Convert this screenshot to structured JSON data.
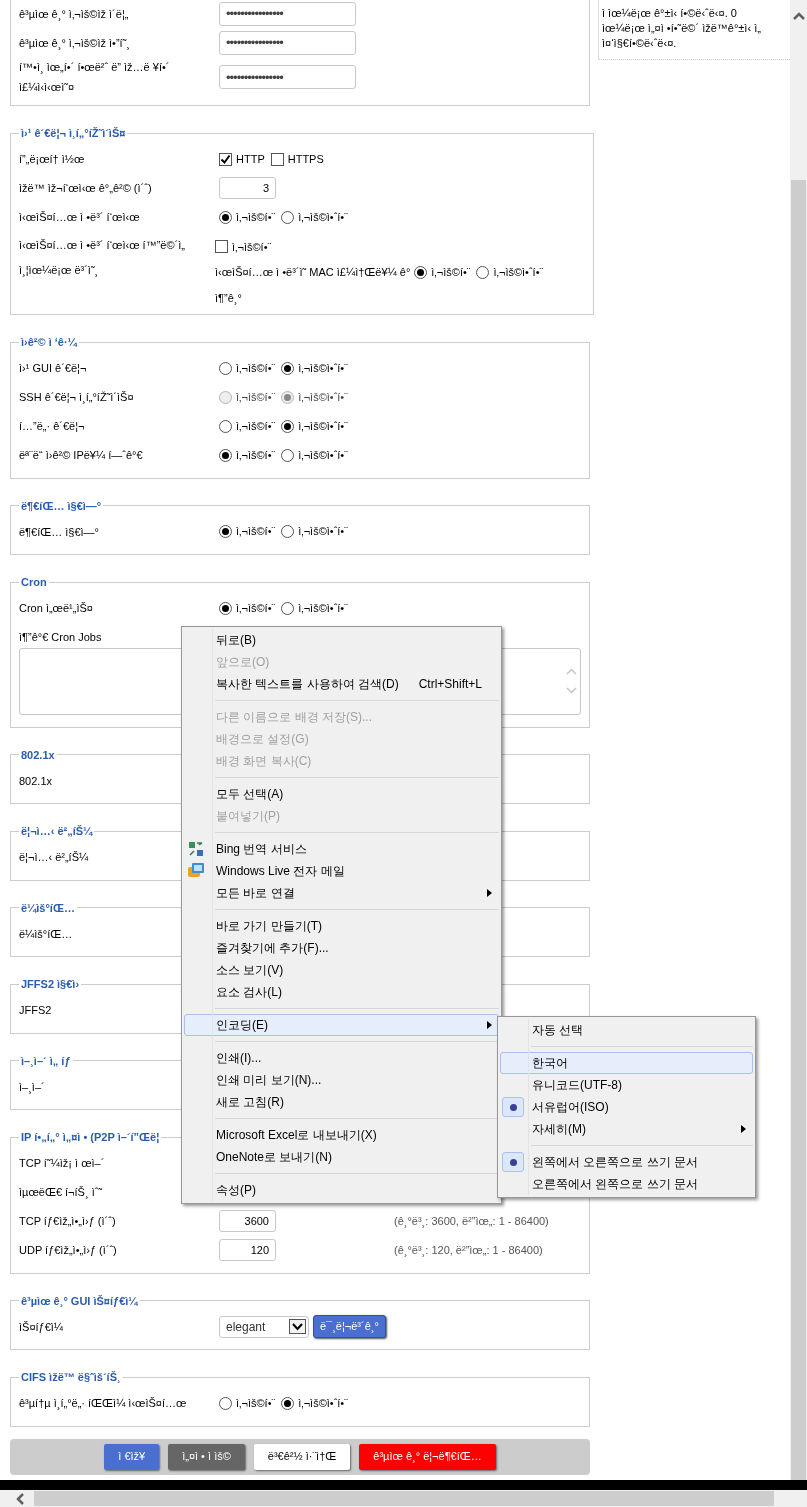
{
  "sections": [
    {
      "rows": [
        {
          "kind": "password",
          "label": "ê³µìœ ê¸° ì‚¬ìš©ìž ì´ë¦„",
          "value": "••••••••••••••••"
        },
        {
          "kind": "password",
          "label": "ê³µìœ ê¸° ì‚¬ìš©ìž ì•”í˜¸",
          "value": "••••••••••••••••"
        },
        {
          "kind": "password",
          "label": "í™•ì¸ ìœ„í•´ í•œë²ˆ ë” ìž…ë ¥í•´ ì£¼ì‹ì‹œì˜¤",
          "value": "••••••••••••••••"
        }
      ]
    },
    {
      "title": "ì›¹ ê´€ë¦¬ ì¸í„°íŽ˜ì´ìŠ¤",
      "rows": [
        {
          "kind": "checkboxes",
          "label": "í”„ë¡œí† ì½œ",
          "options": [
            {
              "label": "HTTP",
              "checked": true
            },
            {
              "label": "HTTPS",
              "checked": false
            }
          ]
        },
        {
          "kind": "number",
          "label": "ìžë™ ìž¬í‘œì‹œ ê°„ê²© (ì´ˆ)",
          "value": "3"
        },
        {
          "kind": "radios",
          "label": "ì‹œìŠ¤í…œ ì •ë³´ í‘œì‹œ",
          "disabled": false,
          "options": [
            {
              "label": "ì‚¬ìš©í•¨",
              "selected": true
            },
            {
              "label": "ì‚¬ìš©ì•ˆí•¨",
              "selected": false
            }
          ]
        },
        {
          "kind": "mac",
          "label": "ì‹œìŠ¤í…œ ì •ë³´ í‘œì‹œ í™”ë©´ì„ ì¸¦ìœ¼ë¡œ ë³´ì˜¸",
          "checkbox": {
            "label": "ì‚¬ìš©í•¨",
            "checked": false
          },
          "mac_label": "ì‹œìŠ¤í…œ ì •ë³´ì˜ MAC ì£¼ì†Œë¥¼ ê°",
          "options": [
            {
              "label": "ì‚¬ìš©í•¨",
              "selected": true
            },
            {
              "label": "ì‚¬ìš©ì•ˆí•¨",
              "selected": false
            }
          ],
          "mac_suffix": "ì¶”ê¸°"
        }
      ]
    },
    {
      "title": "ì›ê²© ì ‘ê·¼",
      "rows": [
        {
          "kind": "radios",
          "label": "ì›¹ GUI ê´€ë¦¬",
          "disabled": false,
          "options": [
            {
              "label": "ì‚¬ìš©í•¨",
              "selected": false
            },
            {
              "label": "ì‚¬ìš©ì•ˆí•¨",
              "selected": true
            }
          ]
        },
        {
          "kind": "radios",
          "label": "SSH ê´€ë¦¬ ì¸í„°íŽ˜ì´ìŠ¤",
          "disabled": true,
          "options": [
            {
              "label": "ì‚¬ìš©í•¨",
              "selected": false
            },
            {
              "label": "ì‚¬ìš©ì•ˆí•¨",
              "selected": true
            }
          ]
        },
        {
          "kind": "radios",
          "label": "í…”ë„· ê´€ë¦¬",
          "disabled": false,
          "options": [
            {
              "label": "ì‚¬ìš©í•¨",
              "selected": false
            },
            {
              "label": "ì‚¬ìš©ì•ˆí•¨",
              "selected": true
            }
          ]
        },
        {
          "kind": "radios",
          "label": "ëª¨ë“  ì›ê²© IPë¥¼ í—ˆê°€",
          "disabled": false,
          "options": [
            {
              "label": "ì‚¬ìš©í•¨",
              "selected": true
            },
            {
              "label": "ì‚¬ìš©ì•ˆí•¨",
              "selected": false
            }
          ]
        }
      ]
    },
    {
      "title": "ë¶€íŒ… ì§€ì—°",
      "rows": [
        {
          "kind": "radios",
          "label": "ë¶€íŒ… ì§€ì—°",
          "disabled": false,
          "options": [
            {
              "label": "ì‚¬ìš©í•¨",
              "selected": true
            },
            {
              "label": "ì‚¬ìš©ì•ˆí•¨",
              "selected": false
            }
          ]
        }
      ]
    },
    {
      "title": "Cron",
      "rows": [
        {
          "kind": "radios",
          "label": "Cron ì„œë¹„ìŠ¤",
          "disabled": false,
          "options": [
            {
              "label": "ì‚¬ìš©í•¨",
              "selected": true
            },
            {
              "label": "ì‚¬ìš©ì•ˆí•¨",
              "selected": false
            }
          ]
        },
        {
          "kind": "textarea",
          "label": "ì¶”ê°€ Cron Jobs"
        }
      ]
    },
    {
      "title": "802.1x",
      "rows": [
        {
          "kind": "text",
          "label": "802.1x"
        }
      ]
    },
    {
      "title": "ë¦¬ì…‹ ë²„íŠ¼",
      "rows": [
        {
          "kind": "text",
          "label": "ë¦¬ì…‹ ë²„íŠ¼"
        }
      ]
    },
    {
      "title": "ë¼ìš°íŒ…",
      "rows": [
        {
          "kind": "text",
          "label": "ë¼ìš°íŒ…"
        }
      ]
    },
    {
      "title": "JFFS2 ì§€ì›",
      "rows": [
        {
          "kind": "text",
          "label": "JFFS2"
        }
      ]
    },
    {
      "title": "ì–¸ì–´ ì„ íƒ",
      "rows": [
        {
          "kind": "text",
          "label": "ì–¸ì–´"
        }
      ]
    },
    {
      "title": "IP í•„í„° ì„¤ì • (P2P ì–´í”Œë¦",
      "rows": [
        {
          "kind": "text",
          "label": "TCP í˜¼ìž¡ ì œì–´"
        },
        {
          "kind": "text",
          "label": "ìµœëŒ€ í¬íŠ¸ ìˆ˜"
        },
        {
          "kind": "number",
          "label": "TCP íƒ€ìž„ì•„ì›ƒ (ì´ˆ)",
          "value": "3600",
          "hint": "(ê¸°ë³¸: 3600, ë²”ìœ„: 1 - 86400)"
        },
        {
          "kind": "number",
          "label": "UDP íƒ€ìž„ì•„ì›ƒ (ì´ˆ)",
          "value": "120",
          "hint": "(ê¸°ë³¸: 120, ë²”ìœ„: 1 - 86400)"
        }
      ]
    },
    {
      "title": "ê³µìœ ê¸° GUI ìŠ¤íƒ€ì¼",
      "rows": [
        {
          "kind": "select",
          "label": "ìŠ¤íƒ€ì¼",
          "value": "elegant",
          "button": "ë¯¸ë¦¬ë³´ê¸°"
        }
      ]
    },
    {
      "title": "CIFS ìžë™ ë§ˆìš´íŠ¸",
      "rows": [
        {
          "kind": "radios",
          "label": "ê³µí†µ ì¸í„°ë„· íŒŒì¼ ì‹œìŠ¤í…œ",
          "disabled": false,
          "options": [
            {
              "label": "ì‚¬ìš©í•¨",
              "selected": false
            },
            {
              "label": "ì‚¬ìš©ì•ˆí•¨",
              "selected": true
            }
          ]
        }
      ]
    }
  ],
  "actions": [
    {
      "label": "ì €ìž¥",
      "kind": "primary"
    },
    {
      "label": "ì„¤ì • ì ìš©",
      "kind": "secondary"
    },
    {
      "label": "ë³€ê²½ ì·¨ì†Œ",
      "kind": "plain"
    },
    {
      "label": "ê³µìœ ê¸° ë¦¬ë¶€íŒ…",
      "kind": "danger"
    }
  ],
  "help_lines": [
    "ì ìœ¼ë¡œ ê°±ì‹ í•©ë‹ˆë‹¤. 0",
    "ìœ¼ë¡œ ì„¤ì •í•˜ë©´ ìžë™ê°±ì‹ ì„",
    "ì¤‘ì§€í•©ë‹ˆë‹¤."
  ],
  "context_menu": {
    "groups": [
      [
        {
          "label": "뒤로(B)",
          "disabled": false
        },
        {
          "label": "앞으로(O)",
          "disabled": true
        },
        {
          "label": "복사한 텍스트를 사용하여 검색(D)",
          "shortcut": "Ctrl+Shift+L",
          "disabled": false
        }
      ],
      [
        {
          "label": "다른 이름으로 배경 저장(S)...",
          "disabled": true
        },
        {
          "label": "배경으로 설정(G)",
          "disabled": true
        },
        {
          "label": "배경 화면 복사(C)",
          "disabled": true
        }
      ],
      [
        {
          "label": "모두 선택(A)",
          "disabled": false
        },
        {
          "label": "붙여넣기(P)",
          "disabled": true
        }
      ],
      [
        {
          "label": "Bing 번역 서비스",
          "disabled": false,
          "kind": "translate"
        },
        {
          "label": "Windows Live 전자 메일",
          "disabled": false,
          "kind": "mail"
        },
        {
          "label": "모든 바로 연결",
          "disabled": false,
          "submenu": true
        }
      ],
      [
        {
          "label": "바로 가기 만들기(T)",
          "disabled": false
        },
        {
          "label": "즐겨찾기에 추가(F)...",
          "disabled": false
        },
        {
          "label": "소스 보기(V)",
          "disabled": false
        },
        {
          "label": "요소 검사(L)",
          "disabled": false
        }
      ],
      [
        {
          "label": "인코딩(E)",
          "disabled": false,
          "submenu": true,
          "selected": true
        }
      ],
      [
        {
          "label": "인쇄(I)...",
          "disabled": false
        },
        {
          "label": "인쇄 미리 보기(N)...",
          "disabled": false
        },
        {
          "label": "새로 고침(R)",
          "disabled": false
        }
      ],
      [
        {
          "label": "Microsoft Excel로 내보내기(X)",
          "disabled": false
        },
        {
          "label": "OneNote로 보내기(N)",
          "disabled": false
        }
      ],
      [
        {
          "label": "속성(P)",
          "disabled": false
        }
      ]
    ]
  },
  "encoding_menu": {
    "groups": [
      [
        {
          "label": "자동 선택",
          "checked": false,
          "selected": false
        }
      ],
      [
        {
          "label": "한국어",
          "checked": false,
          "selected": true
        },
        {
          "label": "유니코드(UTF-8)",
          "checked": false,
          "selected": false
        },
        {
          "label": "서유럽어(ISO)",
          "checked": true,
          "selected": false
        },
        {
          "label": "자세히(M)",
          "checked": false,
          "selected": false,
          "submenu": true
        }
      ],
      [
        {
          "label": "왼쪽에서 오른쪽으로 쓰기 문서",
          "checked": true,
          "selected": false
        },
        {
          "label": "오른쪽에서 왼쪽으로 쓰기 문서",
          "checked": false,
          "selected": false
        }
      ]
    ]
  }
}
